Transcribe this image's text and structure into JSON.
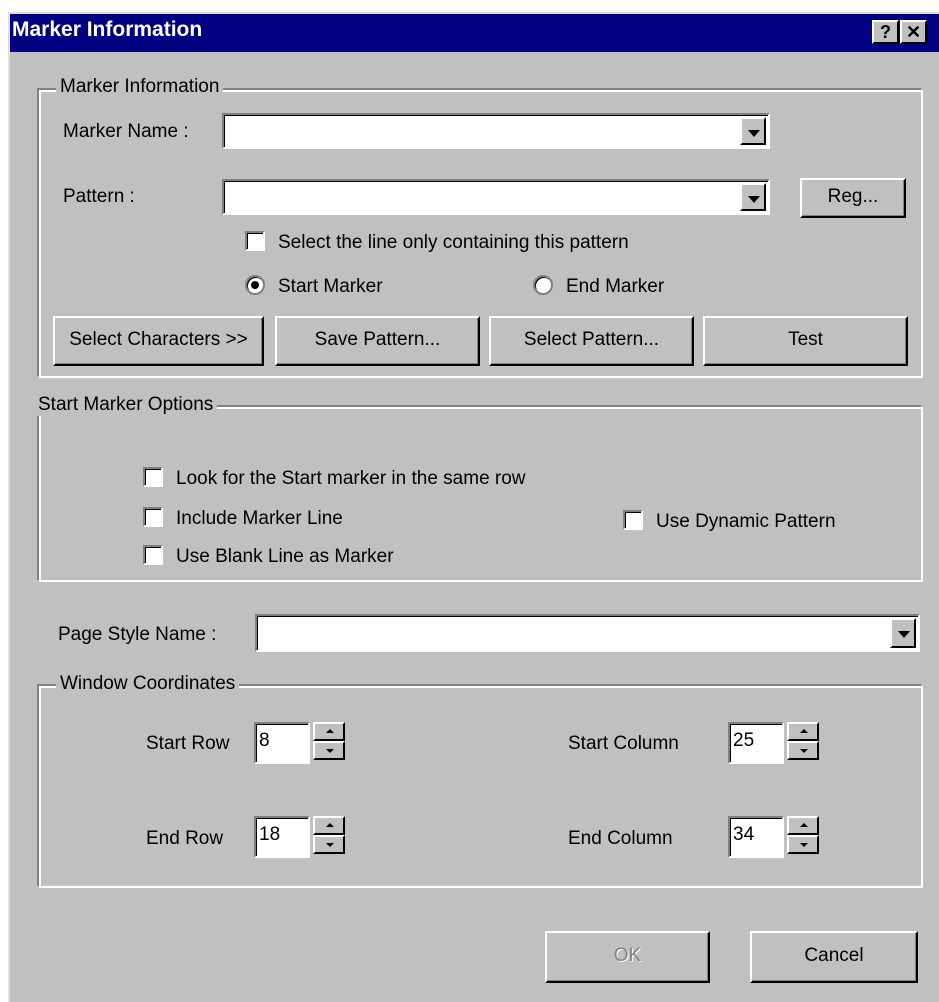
{
  "window": {
    "title": "Marker Information",
    "help_icon": "question-mark",
    "close_icon": "x"
  },
  "marker_group": {
    "label": "Marker Information",
    "marker_name_label": "Marker Name  :",
    "marker_name_value": "",
    "pattern_label": "Pattern  :",
    "pattern_value": "",
    "reg_button": "Reg...",
    "select_line_checkbox": "Select the line only containing this pattern",
    "select_line_checked": false,
    "start_marker_radio": "Start Marker",
    "end_marker_radio": "End Marker",
    "selected_marker": "start",
    "buttons": {
      "select_characters": "Select Characters >>",
      "save_pattern": "Save Pattern...",
      "select_pattern": "Select Pattern...",
      "test": "Test"
    }
  },
  "start_marker_options": {
    "label": "Start Marker Options",
    "same_row": "Look for the Start marker in the same row",
    "include_line": "Include Marker Line",
    "blank_line": "Use Blank Line as Marker",
    "dynamic_pattern": "Use Dynamic Pattern"
  },
  "page_style": {
    "label": "Page Style Name :",
    "value": ""
  },
  "window_coordinates": {
    "label": "Window Coordinates",
    "start_row_label": "Start Row",
    "start_row_value": "8",
    "end_row_label": "End Row",
    "end_row_value": "18",
    "start_column_label": "Start Column",
    "start_column_value": "25",
    "end_column_label": "End Column",
    "end_column_value": "34"
  },
  "footer": {
    "ok": "OK",
    "cancel": "Cancel"
  },
  "colors": {
    "titlebar": "#000080",
    "face": "#c0c0c0"
  }
}
